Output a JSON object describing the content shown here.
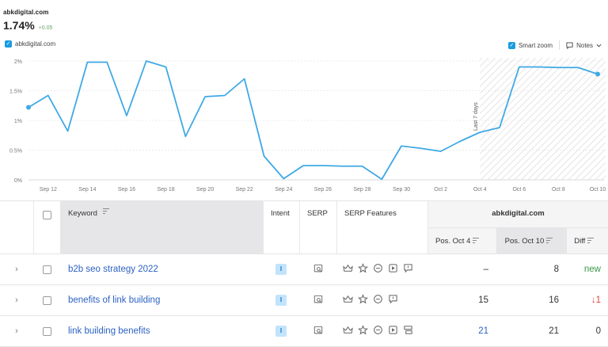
{
  "header": {
    "domain": "abkdigital.com",
    "visibility": "1.74%",
    "visibility_change": "+0.05"
  },
  "legend": {
    "series_label": "abkdigital.com"
  },
  "controls": {
    "smart_zoom_label": "Smart zoom",
    "notes_label": "Notes"
  },
  "colors": {
    "accent": "#1a9be0",
    "line": "#3fa9e4",
    "intent_bg": "#c2e4fb",
    "positive": "#3c9a4a",
    "negative": "#e0453a"
  },
  "chart_data": {
    "type": "line",
    "x": [
      "Sep 11",
      "Sep 12",
      "Sep 13",
      "Sep 14",
      "Sep 15",
      "Sep 16",
      "Sep 17",
      "Sep 18",
      "Sep 19",
      "Sep 20",
      "Sep 21",
      "Sep 22",
      "Sep 23",
      "Sep 24",
      "Sep 25",
      "Sep 26",
      "Sep 27",
      "Sep 28",
      "Sep 29",
      "Sep 30",
      "Oct 1",
      "Oct 2",
      "Oct 3",
      "Oct 4",
      "Oct 5",
      "Oct 6",
      "Oct 7",
      "Oct 8",
      "Oct 9",
      "Oct 10"
    ],
    "series": [
      {
        "values": [
          1.22,
          1.42,
          0.82,
          1.98,
          1.98,
          1.08,
          2.0,
          1.9,
          0.73,
          1.4,
          1.42,
          1.7,
          0.4,
          0.02,
          0.24,
          0.24,
          0.23,
          0.23,
          0.01,
          0.57,
          0.53,
          0.48,
          0.65,
          0.8,
          0.88,
          1.9,
          1.9,
          1.89,
          1.89,
          1.78
        ]
      }
    ],
    "xticks": [
      "Sep 12",
      "Sep 14",
      "Sep 16",
      "Sep 18",
      "Sep 20",
      "Sep 22",
      "Sep 24",
      "Sep 26",
      "Sep 28",
      "Sep 30",
      "Oct 2",
      "Oct 4",
      "Oct 6",
      "Oct 8",
      "Oct 10"
    ],
    "yticks": [
      "0%",
      "0.5%",
      "1%",
      "1.5%",
      "2%"
    ],
    "ylim": [
      0,
      2
    ],
    "annotation": "Last 7 days",
    "grid": true
  },
  "table": {
    "headers": {
      "keyword": "Keyword",
      "intent": "Intent",
      "serp": "SERP",
      "serp_features": "SERP Features",
      "domain": "abkdigital.com",
      "pos_a": "Pos. Oct 4",
      "pos_b": "Pos. Oct 10",
      "diff": "Diff"
    },
    "rows": [
      {
        "keyword": "b2b seo strategy 2022",
        "intent": "I",
        "features": [
          "crown",
          "star",
          "link",
          "video",
          "review"
        ],
        "pos_a": "–",
        "pos_b": "8",
        "diff": "new",
        "diff_type": "green",
        "pos_a_type": ""
      },
      {
        "keyword": "benefits of link building",
        "intent": "I",
        "features": [
          "crown",
          "star",
          "link",
          "review"
        ],
        "pos_a": "15",
        "pos_b": "16",
        "diff": "↓1",
        "diff_type": "red",
        "pos_a_type": ""
      },
      {
        "keyword": "link building benefits",
        "intent": "I",
        "features": [
          "crown",
          "star",
          "link",
          "video",
          "sitelinks"
        ],
        "pos_a": "21",
        "pos_b": "21",
        "diff": "0",
        "diff_type": "",
        "pos_a_type": "blue"
      }
    ]
  }
}
